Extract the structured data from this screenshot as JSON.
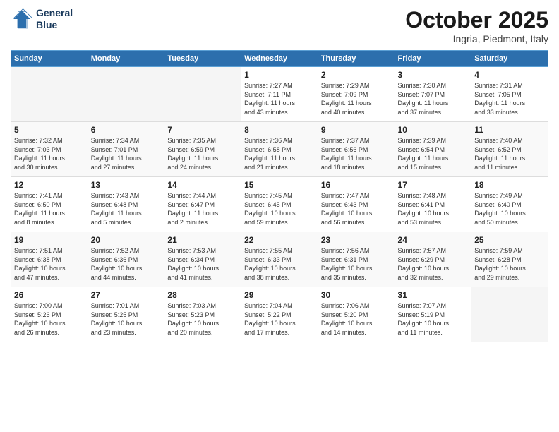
{
  "header": {
    "logo_line1": "General",
    "logo_line2": "Blue",
    "month": "October 2025",
    "location": "Ingria, Piedmont, Italy"
  },
  "days_of_week": [
    "Sunday",
    "Monday",
    "Tuesday",
    "Wednesday",
    "Thursday",
    "Friday",
    "Saturday"
  ],
  "weeks": [
    [
      {
        "day": "",
        "info": ""
      },
      {
        "day": "",
        "info": ""
      },
      {
        "day": "",
        "info": ""
      },
      {
        "day": "1",
        "info": "Sunrise: 7:27 AM\nSunset: 7:11 PM\nDaylight: 11 hours\nand 43 minutes."
      },
      {
        "day": "2",
        "info": "Sunrise: 7:29 AM\nSunset: 7:09 PM\nDaylight: 11 hours\nand 40 minutes."
      },
      {
        "day": "3",
        "info": "Sunrise: 7:30 AM\nSunset: 7:07 PM\nDaylight: 11 hours\nand 37 minutes."
      },
      {
        "day": "4",
        "info": "Sunrise: 7:31 AM\nSunset: 7:05 PM\nDaylight: 11 hours\nand 33 minutes."
      }
    ],
    [
      {
        "day": "5",
        "info": "Sunrise: 7:32 AM\nSunset: 7:03 PM\nDaylight: 11 hours\nand 30 minutes."
      },
      {
        "day": "6",
        "info": "Sunrise: 7:34 AM\nSunset: 7:01 PM\nDaylight: 11 hours\nand 27 minutes."
      },
      {
        "day": "7",
        "info": "Sunrise: 7:35 AM\nSunset: 6:59 PM\nDaylight: 11 hours\nand 24 minutes."
      },
      {
        "day": "8",
        "info": "Sunrise: 7:36 AM\nSunset: 6:58 PM\nDaylight: 11 hours\nand 21 minutes."
      },
      {
        "day": "9",
        "info": "Sunrise: 7:37 AM\nSunset: 6:56 PM\nDaylight: 11 hours\nand 18 minutes."
      },
      {
        "day": "10",
        "info": "Sunrise: 7:39 AM\nSunset: 6:54 PM\nDaylight: 11 hours\nand 15 minutes."
      },
      {
        "day": "11",
        "info": "Sunrise: 7:40 AM\nSunset: 6:52 PM\nDaylight: 11 hours\nand 11 minutes."
      }
    ],
    [
      {
        "day": "12",
        "info": "Sunrise: 7:41 AM\nSunset: 6:50 PM\nDaylight: 11 hours\nand 8 minutes."
      },
      {
        "day": "13",
        "info": "Sunrise: 7:43 AM\nSunset: 6:48 PM\nDaylight: 11 hours\nand 5 minutes."
      },
      {
        "day": "14",
        "info": "Sunrise: 7:44 AM\nSunset: 6:47 PM\nDaylight: 11 hours\nand 2 minutes."
      },
      {
        "day": "15",
        "info": "Sunrise: 7:45 AM\nSunset: 6:45 PM\nDaylight: 10 hours\nand 59 minutes."
      },
      {
        "day": "16",
        "info": "Sunrise: 7:47 AM\nSunset: 6:43 PM\nDaylight: 10 hours\nand 56 minutes."
      },
      {
        "day": "17",
        "info": "Sunrise: 7:48 AM\nSunset: 6:41 PM\nDaylight: 10 hours\nand 53 minutes."
      },
      {
        "day": "18",
        "info": "Sunrise: 7:49 AM\nSunset: 6:40 PM\nDaylight: 10 hours\nand 50 minutes."
      }
    ],
    [
      {
        "day": "19",
        "info": "Sunrise: 7:51 AM\nSunset: 6:38 PM\nDaylight: 10 hours\nand 47 minutes."
      },
      {
        "day": "20",
        "info": "Sunrise: 7:52 AM\nSunset: 6:36 PM\nDaylight: 10 hours\nand 44 minutes."
      },
      {
        "day": "21",
        "info": "Sunrise: 7:53 AM\nSunset: 6:34 PM\nDaylight: 10 hours\nand 41 minutes."
      },
      {
        "day": "22",
        "info": "Sunrise: 7:55 AM\nSunset: 6:33 PM\nDaylight: 10 hours\nand 38 minutes."
      },
      {
        "day": "23",
        "info": "Sunrise: 7:56 AM\nSunset: 6:31 PM\nDaylight: 10 hours\nand 35 minutes."
      },
      {
        "day": "24",
        "info": "Sunrise: 7:57 AM\nSunset: 6:29 PM\nDaylight: 10 hours\nand 32 minutes."
      },
      {
        "day": "25",
        "info": "Sunrise: 7:59 AM\nSunset: 6:28 PM\nDaylight: 10 hours\nand 29 minutes."
      }
    ],
    [
      {
        "day": "26",
        "info": "Sunrise: 7:00 AM\nSunset: 5:26 PM\nDaylight: 10 hours\nand 26 minutes."
      },
      {
        "day": "27",
        "info": "Sunrise: 7:01 AM\nSunset: 5:25 PM\nDaylight: 10 hours\nand 23 minutes."
      },
      {
        "day": "28",
        "info": "Sunrise: 7:03 AM\nSunset: 5:23 PM\nDaylight: 10 hours\nand 20 minutes."
      },
      {
        "day": "29",
        "info": "Sunrise: 7:04 AM\nSunset: 5:22 PM\nDaylight: 10 hours\nand 17 minutes."
      },
      {
        "day": "30",
        "info": "Sunrise: 7:06 AM\nSunset: 5:20 PM\nDaylight: 10 hours\nand 14 minutes."
      },
      {
        "day": "31",
        "info": "Sunrise: 7:07 AM\nSunset: 5:19 PM\nDaylight: 10 hours\nand 11 minutes."
      },
      {
        "day": "",
        "info": ""
      }
    ]
  ]
}
